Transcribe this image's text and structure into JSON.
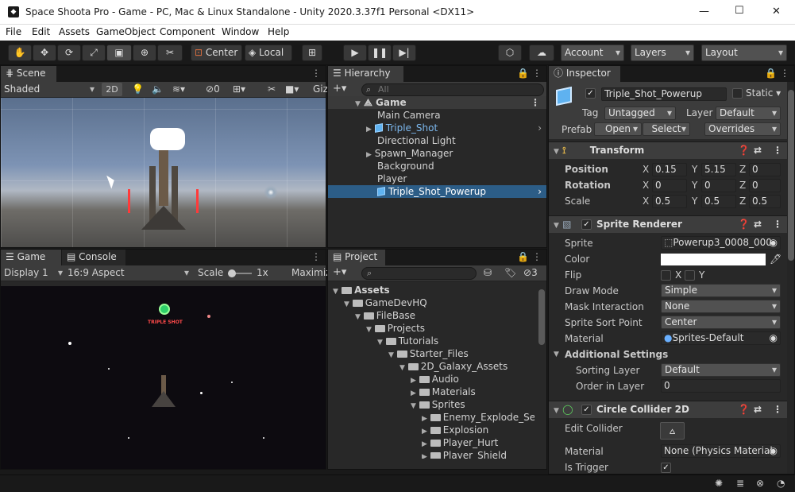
{
  "window": {
    "title": "Space Shoota Pro - Game - PC, Mac & Linux Standalone - Unity 2020.3.37f1 Personal <DX11>",
    "minimize": "—",
    "maximize": "☐",
    "close": "✕"
  },
  "menu": [
    "File",
    "Edit",
    "Assets",
    "GameObject",
    "Component",
    "Window",
    "Help"
  ],
  "toolbar": {
    "pivot": "Center",
    "space": "Local",
    "account": "Account",
    "layers": "Layers",
    "layout": "Layout"
  },
  "scene": {
    "tab": "Scene",
    "shading": "Shaded",
    "mode2d": "2D",
    "hidden_count": "0",
    "gizmos": "Giz"
  },
  "game": {
    "tab": "Game",
    "console_tab": "Console",
    "display": "Display 1",
    "aspect": "16:9 Aspect",
    "scale_label": "Scale",
    "scale_value": "1x",
    "maximize": "Maximiz",
    "powerup_label": "TRIPLE SHOT"
  },
  "hierarchy": {
    "tab": "Hierarchy",
    "search_placeholder": "All",
    "scene_name": "Game",
    "items": [
      "Main Camera",
      "Triple_Shot",
      "Directional Light",
      "Spawn_Manager",
      "Background",
      "Player",
      "Triple_Shot_Powerup"
    ]
  },
  "project": {
    "tab": "Project",
    "count": "3",
    "tree": [
      "Assets",
      "GameDevHQ",
      "FileBase",
      "Projects",
      "Tutorials",
      "Starter_Files",
      "2D_Galaxy_Assets",
      "Audio",
      "Materials",
      "Sprites",
      "Enemy_Explode_Sequ",
      "Explosion",
      "Player_Hurt",
      "Player_Shield"
    ]
  },
  "inspector": {
    "tab": "Inspector",
    "object_name": "Triple_Shot_Powerup",
    "static": "Static",
    "tag_label": "Tag",
    "tag": "Untagged",
    "layer_label": "Layer",
    "layer": "Default",
    "prefab_label": "Prefab",
    "open": "Open",
    "select": "Select",
    "overrides": "Overrides",
    "transform": {
      "title": "Transform",
      "position_label": "Position",
      "rotation_label": "Rotation",
      "scale_label": "Scale",
      "position": [
        "0.15",
        "5.15",
        "0"
      ],
      "rotation": [
        "0",
        "0",
        "0"
      ],
      "scale": [
        "0.5",
        "0.5",
        "0.5"
      ],
      "axis": [
        "X",
        "Y",
        "Z"
      ]
    },
    "sprite_renderer": {
      "title": "Sprite Renderer",
      "sprite_label": "Sprite",
      "sprite": "Powerup3_0008_000",
      "color_label": "Color",
      "flip_label": "Flip",
      "flip_x": "X",
      "flip_y": "Y",
      "draw_mode_label": "Draw Mode",
      "draw_mode": "Simple",
      "mask_label": "Mask Interaction",
      "mask": "None",
      "sort_point_label": "Sprite Sort Point",
      "sort_point": "Center",
      "material_label": "Material",
      "material": "Sprites-Default",
      "additional": "Additional Settings",
      "sorting_layer_label": "Sorting Layer",
      "sorting_layer": "Default",
      "order_label": "Order in Layer",
      "order": "0"
    },
    "collider": {
      "title": "Circle Collider 2D",
      "edit_label": "Edit Collider",
      "material_label": "Material",
      "material": "None (Physics Material",
      "trigger_label": "Is Trigger"
    }
  },
  "colors": {
    "selection": "#2c5d87",
    "accent_cube": "#5fb2f0",
    "panel": "#282828",
    "header": "#3d3d3d"
  }
}
